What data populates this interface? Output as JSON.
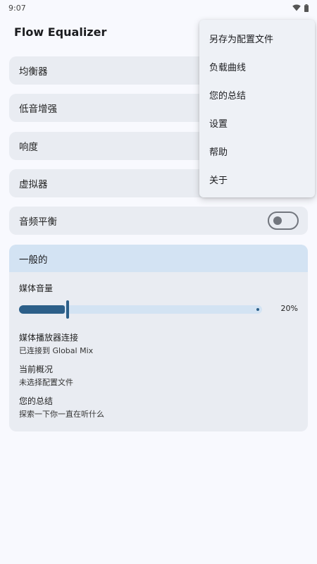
{
  "status_bar": {
    "time": "9:07"
  },
  "app": {
    "title": "Flow Equalizer"
  },
  "cards": {
    "equalizer": "均衡器",
    "bass_boost": "低音增强",
    "loudness": "响度",
    "virtualizer": "虚拟器",
    "audio_balance": "音频平衡",
    "audio_balance_enabled": false
  },
  "general": {
    "header": "一般的",
    "media_volume_label": "媒体音量",
    "media_volume_percent": 20,
    "media_volume_text": "20%",
    "player_connection_title": "媒体播放器连接",
    "player_connection_value": "已连接到 Global Mix",
    "current_profile_title": "当前概况",
    "current_profile_value": "未选择配置文件",
    "summary_title": "您的总结",
    "summary_value": "探索一下你一直在听什么"
  },
  "menu": {
    "items": [
      "另存为配置文件",
      "负载曲线",
      "您的总结",
      "设置",
      "帮助",
      "关于"
    ]
  },
  "colors": {
    "accent": "#2c5f89",
    "accent_light": "#d3e3f3",
    "card": "#e9ecf2",
    "background": "#f8f9fe"
  }
}
